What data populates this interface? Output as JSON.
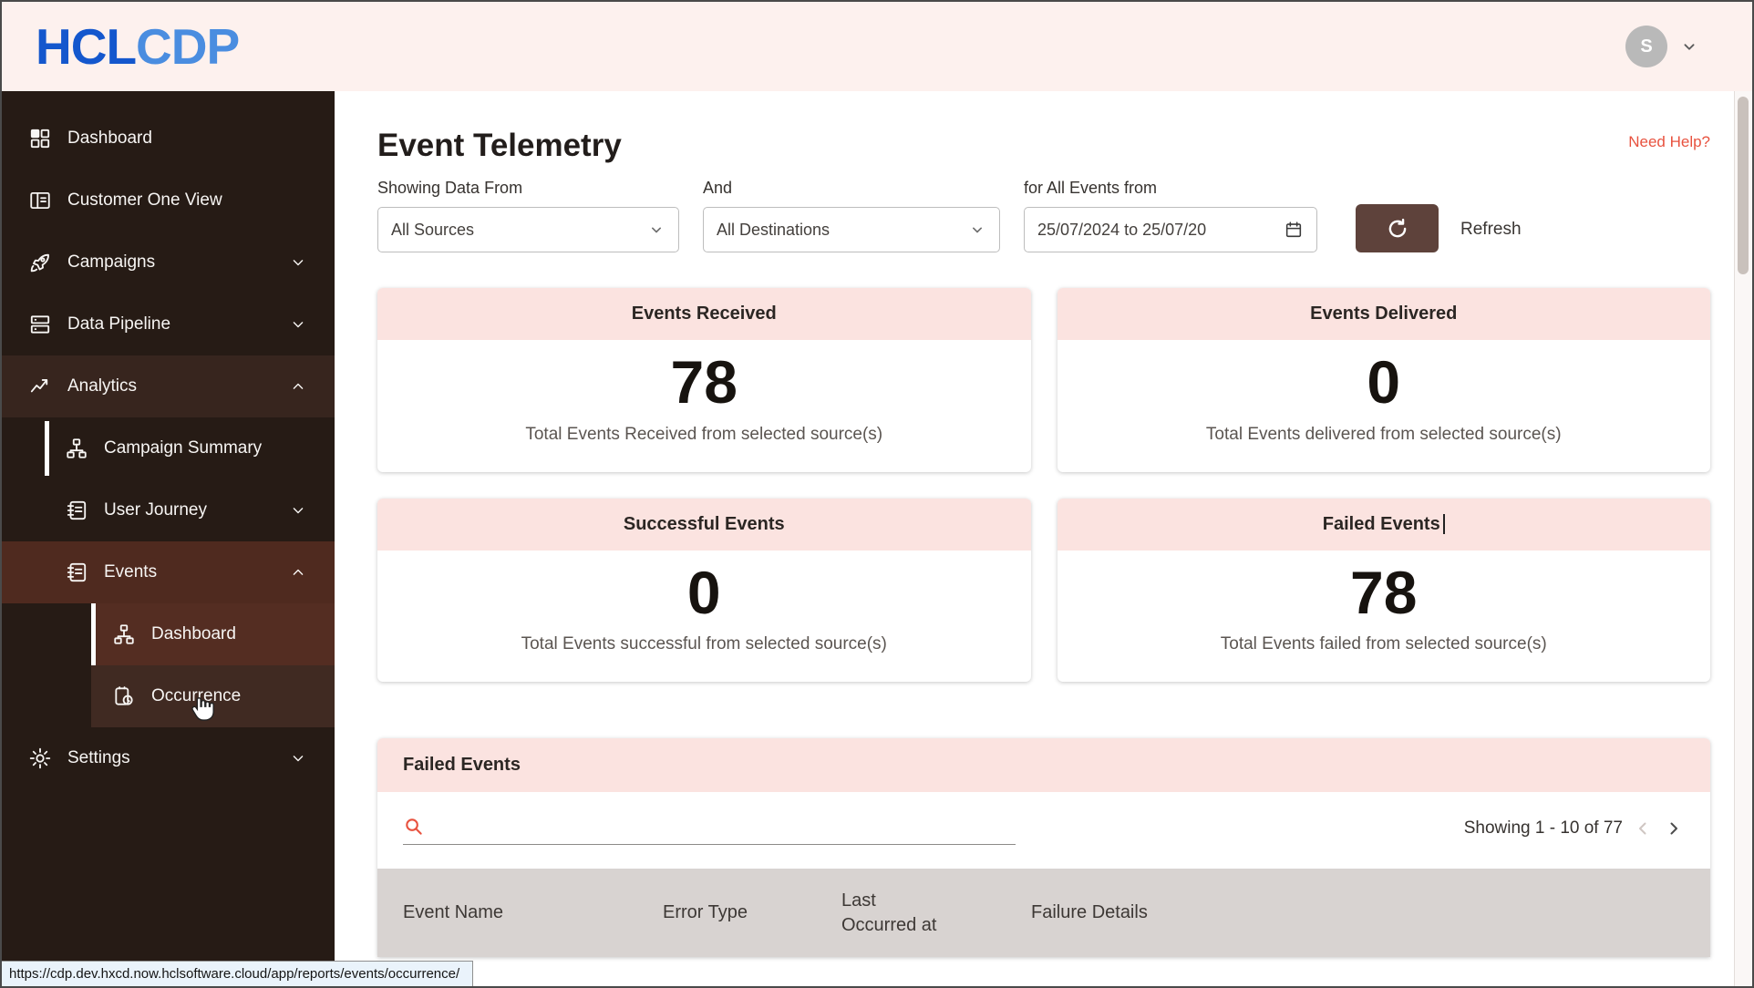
{
  "header": {
    "logo_primary": "HCL",
    "logo_secondary": "CDP",
    "avatar_initial": "S"
  },
  "sidebar": {
    "items": {
      "dashboard": "Dashboard",
      "customer_one_view": "Customer One View",
      "campaigns": "Campaigns",
      "data_pipeline": "Data Pipeline",
      "analytics": "Analytics",
      "campaign_summary": "Campaign Summary",
      "user_journey": "User Journey",
      "events": "Events",
      "events_dashboard": "Dashboard",
      "occurrence": "Occurrence",
      "settings": "Settings"
    }
  },
  "main": {
    "title": "Event Telemetry",
    "need_help": "Need Help?",
    "filters": {
      "source_label": "Showing Data From",
      "and_label": "And",
      "events_from_label": "for All Events from",
      "source_value": "All Sources",
      "destination_value": "All Destinations",
      "date_range_value": "25/07/2024 to 25/07/20",
      "refresh_label": "Refresh"
    },
    "stat_cards": [
      {
        "title": "Events Received",
        "value": "78",
        "caption": "Total Events Received from selected source(s)"
      },
      {
        "title": "Events Delivered",
        "value": "0",
        "caption": "Total Events delivered from selected source(s)"
      },
      {
        "title": "Successful Events",
        "value": "0",
        "caption": "Total Events successful from selected source(s)"
      },
      {
        "title": "Failed Events",
        "value": "78",
        "caption": "Total Events failed from selected source(s)"
      }
    ],
    "failed_events_table": {
      "title": "Failed Events",
      "search_placeholder": "",
      "pagination": "Showing 1 - 10 of 77",
      "columns": [
        "Event Name",
        "Error Type",
        "Last Occurred at",
        "Failure Details"
      ]
    }
  },
  "status_bar": {
    "url": "https://cdp.dev.hxcd.now.hclsoftware.cloud/app/reports/events/occurrence/"
  },
  "colors": {
    "header_bg": "#fdf1ee",
    "sidebar_bg": "#261b15",
    "sidebar_active_bg": "#4f2a1f",
    "card_header_bg": "#fbe3e0",
    "accent_orange": "#e8523f",
    "refresh_button_bg": "#5e423b",
    "logo_primary_blue": "#1457cd",
    "logo_secondary_blue": "#4a8de0",
    "table_header_bg": "#d8d3d1"
  },
  "icons": {
    "dashboard": "grid-2x2",
    "customer_one_view": "contact-card",
    "campaigns": "rocket",
    "data_pipeline": "stacked-trays",
    "analytics": "trend-line-arrow",
    "campaign_summary": "org-hierarchy",
    "user_journey": "journal",
    "events": "journal",
    "events_dashboard": "org-hierarchy",
    "occurrence": "clipboard-clock",
    "settings": "gear",
    "search": "magnifier",
    "refresh": "circular-arrow",
    "calendar": "calendar",
    "avatar": "initial-circle",
    "cursor": "hand-pointer"
  }
}
